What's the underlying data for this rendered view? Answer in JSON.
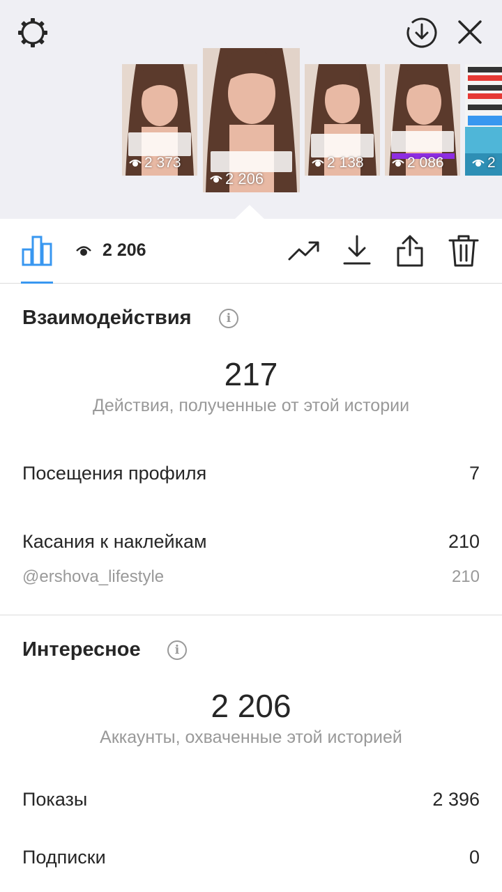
{
  "stories": [
    {
      "views": "2 373"
    },
    {
      "views": "2 206",
      "selected": true
    },
    {
      "views": "2 138"
    },
    {
      "views": "2 086"
    },
    {
      "views": "2"
    }
  ],
  "toolbar": {
    "views_count": "2 206"
  },
  "interactions": {
    "title": "Взаимодействия",
    "total": "217",
    "total_caption": "Действия, полученные от этой истории",
    "profile_visits_label": "Посещения профиля",
    "profile_visits_value": "7",
    "sticker_taps_label": "Касания к наклейкам",
    "sticker_taps_value": "210",
    "sticker_handle": "@ershova_lifestyle",
    "sticker_handle_value": "210"
  },
  "discovery": {
    "title": "Интересное",
    "reach": "2 206",
    "reach_caption": "Аккаунты, охваченные этой историей",
    "impressions_label": "Показы",
    "impressions_value": "2 396",
    "follows_label": "Подписки",
    "follows_value": "0"
  },
  "colors": {
    "accent": "#3897f0",
    "text": "#262626",
    "muted": "#999999",
    "top_bg": "#efeff4"
  },
  "icons": [
    "gear-icon",
    "download-circle-icon",
    "close-icon",
    "bar-chart-icon",
    "eye-icon",
    "trending-icon",
    "download-icon",
    "share-icon",
    "trash-icon",
    "info-icon"
  ]
}
